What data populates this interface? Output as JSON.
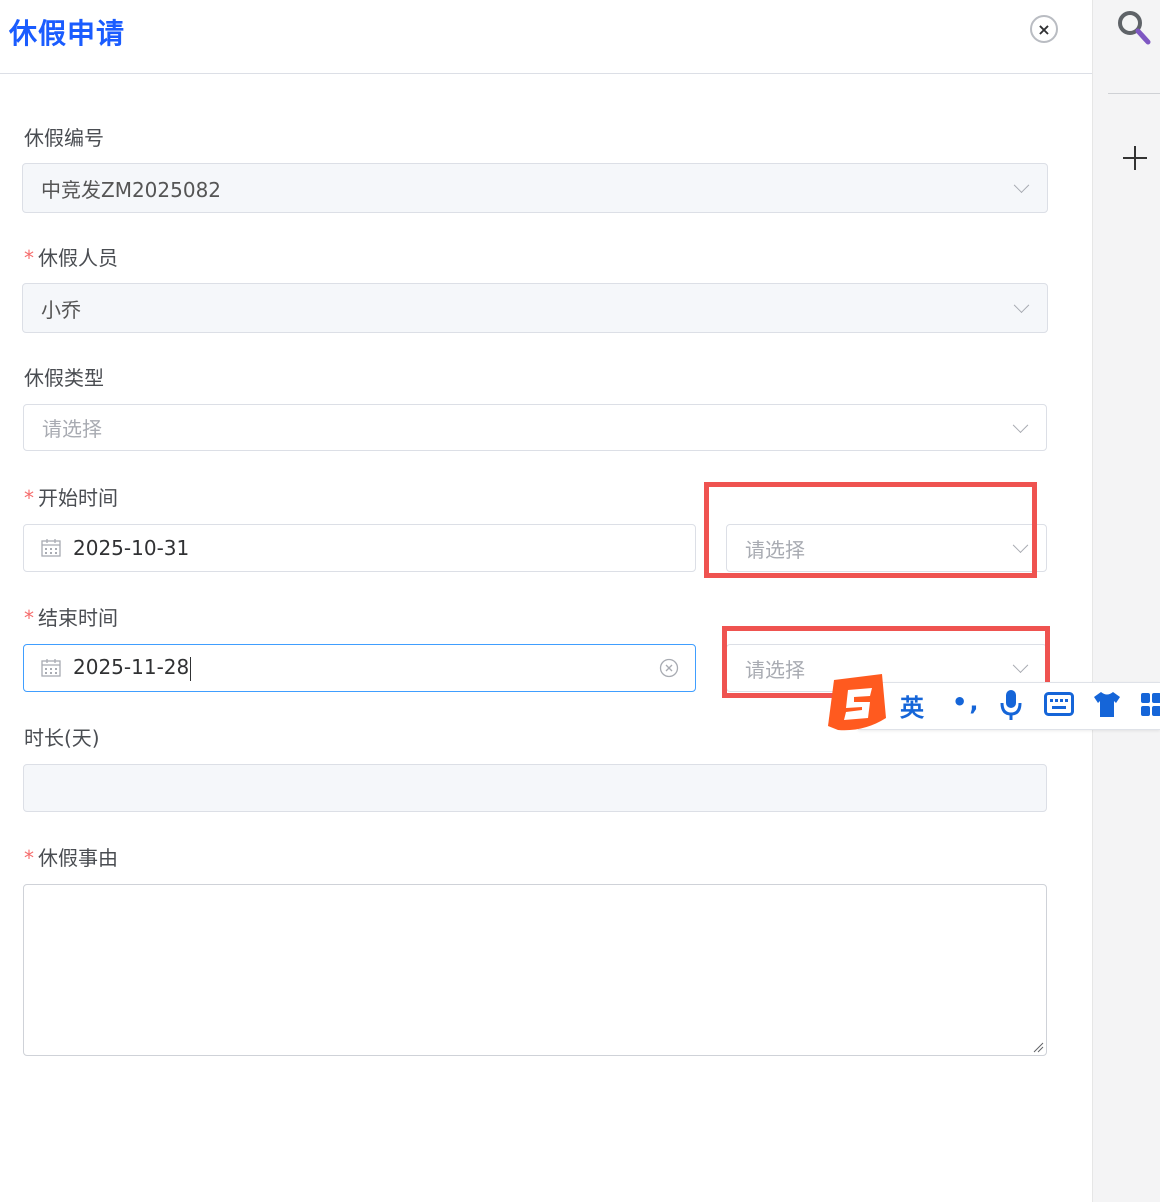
{
  "dialog": {
    "title": "休假申请",
    "close_label": "×"
  },
  "form": {
    "leave_no": {
      "label": "休假编号",
      "value": "中竞发ZM2025082"
    },
    "leave_person": {
      "label": "休假人员",
      "required": "*",
      "value": "小乔"
    },
    "leave_type": {
      "label": "休假类型",
      "placeholder": "请选择"
    },
    "start_time": {
      "label": "开始时间",
      "required": "*",
      "date": "2025-10-31",
      "period_placeholder": "请选择"
    },
    "end_time": {
      "label": "结束时间",
      "required": "*",
      "date": "2025-11-28",
      "period_placeholder": "请选择"
    },
    "duration": {
      "label": "时长(天)",
      "value": ""
    },
    "reason": {
      "label": "休假事由",
      "required": "*",
      "value": ""
    }
  },
  "ime_toolbar": {
    "mode": "英",
    "punct": "•,",
    "icons": [
      "sogou-logo-icon",
      "microphone-icon",
      "keyboard-icon",
      "skin-shirt-icon",
      "toolbox-icon"
    ]
  },
  "sidebar": {
    "icons": [
      "search-icon",
      "plus-icon"
    ]
  },
  "colors": {
    "title_blue": "#1a5cff",
    "required_red": "#f56c6c",
    "highlight_red": "#ef5350",
    "focus_blue": "#409eff",
    "ime_blue": "#1565d8",
    "ime_orange": "#ff5a1f"
  }
}
